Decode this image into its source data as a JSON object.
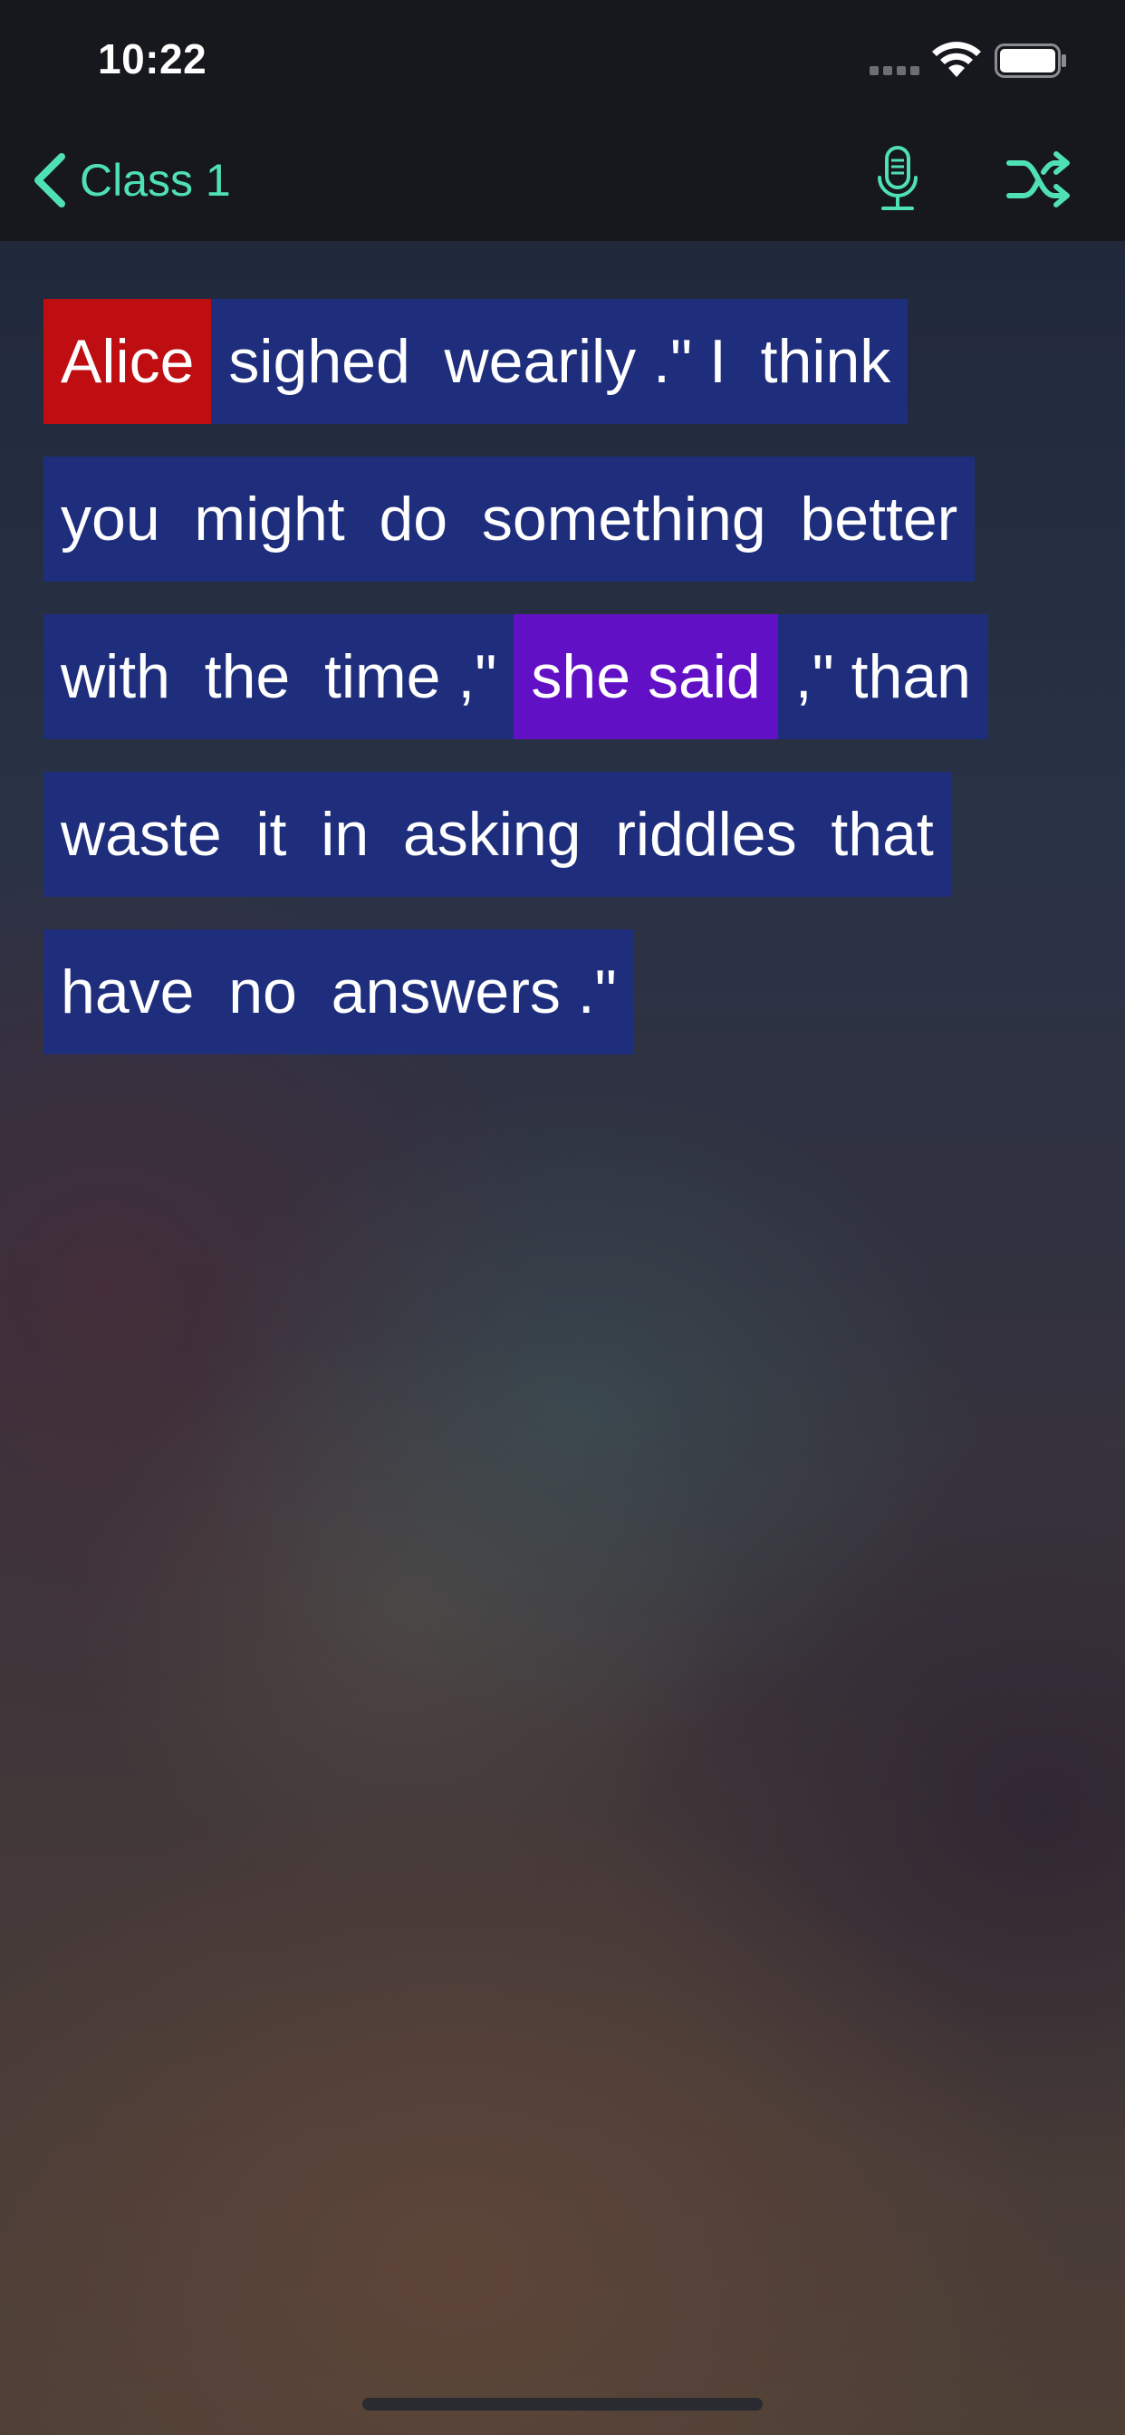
{
  "status_bar": {
    "time": "10:22"
  },
  "nav": {
    "back_label": "Class 1",
    "accent_color": "#4fe0b4",
    "icons": [
      "chevron-left-icon",
      "microphone-icon",
      "shuffle-icon"
    ]
  },
  "sentence": {
    "lines": [
      [
        {
          "text": "Alice",
          "role": "subject",
          "color": "#bf0e12"
        },
        {
          "text": "sighed  wearily .\" I  think",
          "role": "default",
          "color": "#1e2e7c"
        }
      ],
      [
        {
          "text": "you  might  do  something  better",
          "role": "default",
          "color": "#1e2e7c"
        }
      ],
      [
        {
          "text": "with  the  time ,\"",
          "role": "default",
          "color": "#1e2e7c"
        },
        {
          "text": "she said",
          "role": "attribution",
          "color": "#6210c6"
        },
        {
          "text": ",\" than",
          "role": "default",
          "color": "#1e2e7c"
        }
      ],
      [
        {
          "text": "waste  it  in  asking  riddles  that",
          "role": "default",
          "color": "#1e2e7c"
        }
      ],
      [
        {
          "text": "have  no  answers .\"",
          "role": "default",
          "color": "#1e2e7c"
        }
      ]
    ]
  }
}
